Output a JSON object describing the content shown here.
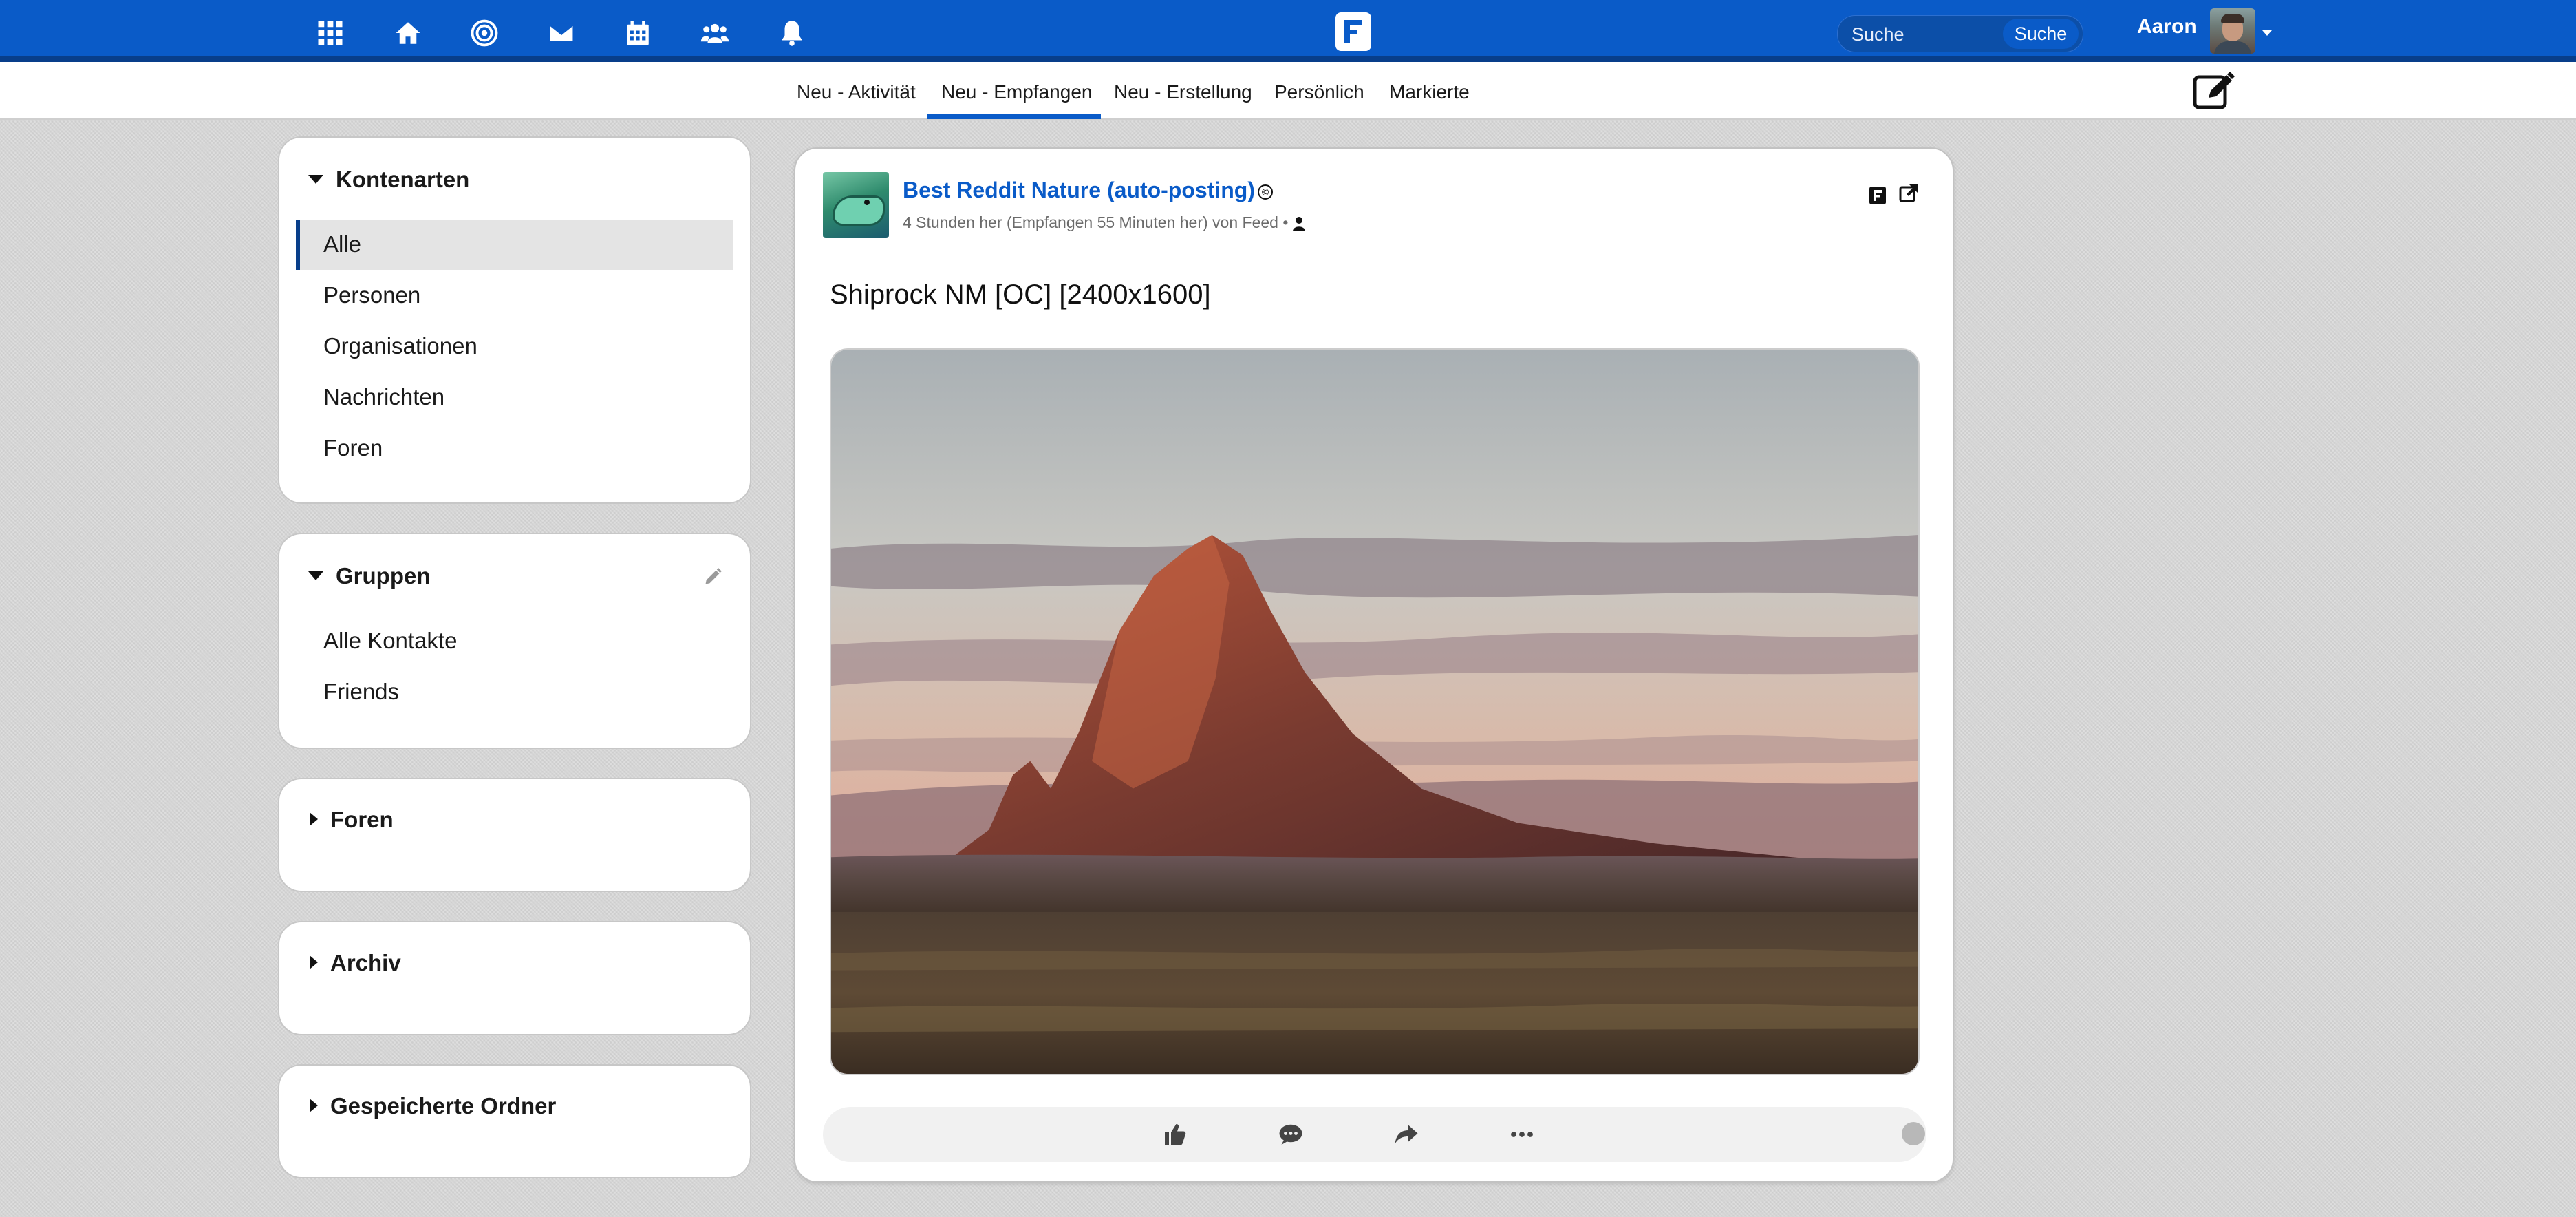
{
  "topbar": {
    "icons": [
      "apps-grid-icon",
      "home-icon",
      "network-target-icon",
      "mail-icon",
      "calendar-icon",
      "contacts-icon",
      "bell-icon"
    ],
    "search": {
      "placeholder": "Suche",
      "button_label": "Suche"
    },
    "user": {
      "name": "Aaron"
    },
    "colors": {
      "primary": "#0a5bc8",
      "primary_dark": "#083e8a"
    }
  },
  "tabs": [
    {
      "label": "Neu - Aktivität"
    },
    {
      "label": "Neu - Empfangen",
      "active": true
    },
    {
      "label": "Neu - Erstellung"
    },
    {
      "label": "Persönlich"
    },
    {
      "label": "Markierte"
    }
  ],
  "sidebar": {
    "account_types": {
      "title": "Kontenarten",
      "items": [
        {
          "label": "Alle",
          "active": true
        },
        {
          "label": "Personen"
        },
        {
          "label": "Organisationen"
        },
        {
          "label": "Nachrichten"
        },
        {
          "label": "Foren"
        }
      ]
    },
    "groups": {
      "title": "Gruppen",
      "items": [
        {
          "label": "Alle Kontakte"
        },
        {
          "label": "Friends"
        }
      ]
    },
    "forums": {
      "title": "Foren"
    },
    "archive": {
      "title": "Archiv"
    },
    "saved_folders": {
      "title": "Gespeicherte Ordner"
    }
  },
  "post": {
    "author": "Best Reddit Nature (auto-posting)",
    "meta": "4 Stunden her (Empfangen 55 Minuten her) von Feed •",
    "title": "Shiprock NM [OC] [2400x1600]",
    "image_alt": "Shiprock NM",
    "actions": [
      "like-icon",
      "comment-icon",
      "share-icon",
      "more-icon"
    ]
  }
}
